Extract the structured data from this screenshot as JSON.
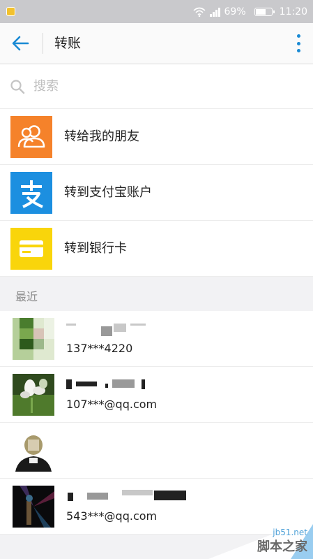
{
  "status_bar": {
    "battery": "69%",
    "battery_level": 0.69,
    "time": "11:20"
  },
  "app_bar": {
    "title": "转账"
  },
  "search": {
    "placeholder": "搜索"
  },
  "options": [
    {
      "label": "转给我的朋友",
      "icon": "friends-icon",
      "color": "#f5822a"
    },
    {
      "label": "转到支付宝账户",
      "icon": "alipay-icon",
      "color": "#1c8fe0"
    },
    {
      "label": "转到银行卡",
      "icon": "bank-card-icon",
      "color": "#f9d50b"
    }
  ],
  "recent": {
    "label": "最近",
    "contacts": [
      {
        "account": "137***4220"
      },
      {
        "account": "107***@qq.com"
      },
      {
        "account": ""
      },
      {
        "account": "543***@qq.com"
      }
    ]
  },
  "watermark": {
    "url": "jb51.net",
    "text": "脚本之家"
  },
  "colors": {
    "accent": "#1a8ad4",
    "status_bar": "#c9c9cc"
  }
}
